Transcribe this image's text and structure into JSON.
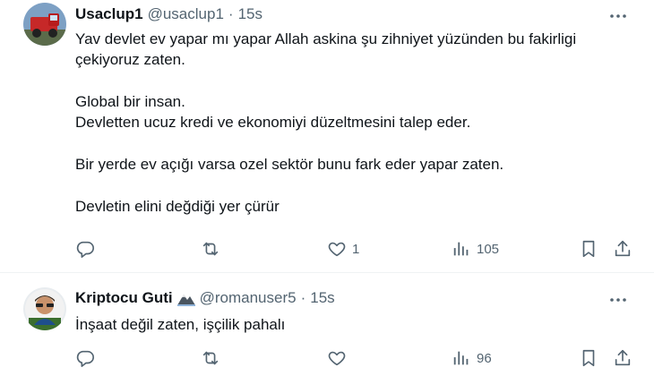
{
  "tweets": [
    {
      "name": "Usaclup1",
      "handle": "@usaclup1",
      "separator": "·",
      "time": "15s",
      "paragraphs": [
        "Yav devlet ev yapar mı yapar Allah askina şu zihniyet yüzünden bu fakirligi çekiyoruz zaten.",
        "Global bir insan.\nDevletten ucuz kredi ve ekonomiyi düzeltmesini talep eder.",
        "Bir yerde ev açığı varsa ozel sektör bunu fark eder yapar zaten.",
        "Devletin elini değdiği yer çürür"
      ],
      "likes": "1",
      "views": "105"
    },
    {
      "name": "Kriptocu Guti",
      "handle": "@romanuser5",
      "separator": "·",
      "time": "15s",
      "paragraphs": [
        "İnşaat değil zaten, işçilik pahalı"
      ],
      "views": "96"
    }
  ],
  "icons": {
    "more": "more-icon",
    "reply": "reply-icon",
    "retweet": "retweet-icon",
    "like": "heart-icon",
    "views": "views-icon",
    "bookmark": "bookmark-icon",
    "share": "share-icon"
  },
  "colors": {
    "text": "#0f1419",
    "muted": "#536471",
    "divider": "#eff3f4"
  }
}
